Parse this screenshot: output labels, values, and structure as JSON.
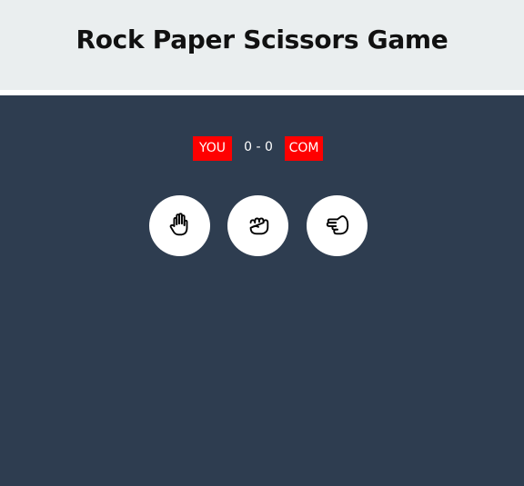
{
  "header": {
    "title": "Rock Paper Scissors Game"
  },
  "scoreboard": {
    "player_label": "YOU",
    "score": "0 - 0",
    "computer_label": "COM",
    "badge_color": "#ff0000"
  },
  "choices": [
    {
      "icon": "hand-paper-icon"
    },
    {
      "icon": "hand-rock-icon"
    },
    {
      "icon": "hand-scissors-icon"
    }
  ],
  "colors": {
    "header_bg": "#eaeeef",
    "main_bg": "#2e3d50",
    "button_bg": "#ffffff"
  }
}
